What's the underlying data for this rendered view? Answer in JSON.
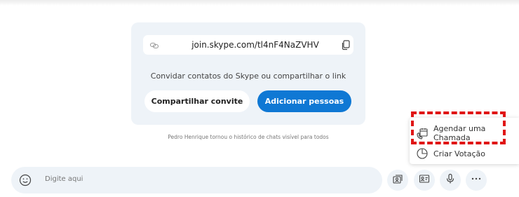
{
  "invite": {
    "link": "join.skype.com/tl4nF4NaZVHV",
    "invite_text": "Convidar contatos do Skype ou compartilhar o link",
    "share_button": "Compartilhar convite",
    "add_button": "Adicionar pessoas"
  },
  "history_note": "Pedro Henrique tornou o histórico de chats visível para todos",
  "compose": {
    "placeholder": "Digite aqui"
  },
  "menu": {
    "schedule_line1": "Agendar uma",
    "schedule_line2": "Chamada",
    "poll": "Criar Votação"
  },
  "colors": {
    "accent": "#0f78d4",
    "card_bg": "#eef3f8",
    "highlight": "#e01515"
  },
  "icons": [
    "link-icon",
    "copy-icon",
    "emoji-icon",
    "schedule-call-icon",
    "poll-icon",
    "contacts-icon",
    "contact-card-icon",
    "microphone-icon",
    "more-icon"
  ]
}
